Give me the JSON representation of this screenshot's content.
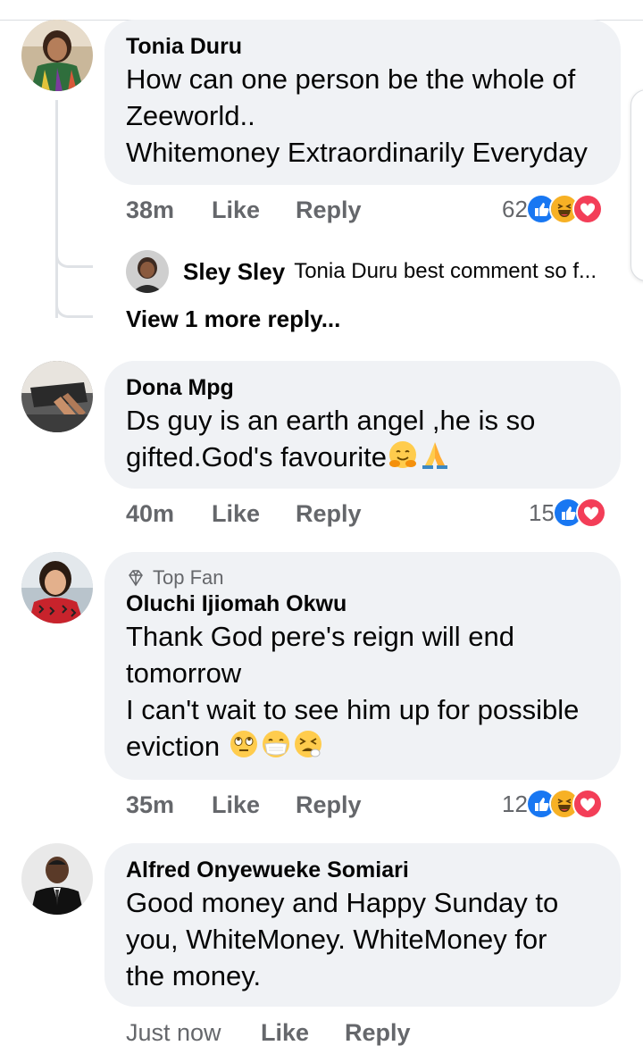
{
  "comments": [
    {
      "author": "Tonia Duru",
      "lines": [
        "How can one person be the whole of",
        "Zeeworld..",
        "Whitemoney Extraordinarily Everyday"
      ],
      "time": "38m",
      "like": "Like",
      "reply": "Reply",
      "reaction_count": "62",
      "reactions": [
        "like-icon",
        "haha-icon",
        "love-icon"
      ]
    },
    {
      "author": "Dona Mpg",
      "lines": [
        "Ds guy is an earth angel ,he is so",
        "gifted.God's favourite"
      ],
      "emojis": [
        "hugging-face-emoji",
        "folded-hands-emoji"
      ],
      "time": "40m",
      "like": "Like",
      "reply": "Reply",
      "reaction_count": "15",
      "reactions": [
        "like-icon",
        "love-icon"
      ]
    },
    {
      "badge": "Top Fan",
      "author": "Oluchi Ijiomah Okwu",
      "lines": [
        "Thank God pere's reign will end",
        "tomorrow",
        "I can't wait to see him up for possible",
        "eviction"
      ],
      "emojis": [
        "eye-roll-emoji",
        "mask-emoji",
        "tired-face-emoji"
      ],
      "time": "35m",
      "like": "Like",
      "reply": "Reply",
      "reaction_count": "12",
      "reactions": [
        "like-icon",
        "haha-icon",
        "love-icon"
      ]
    },
    {
      "author": "Alfred Onyewueke Somiari",
      "lines": [
        "Good money and Happy Sunday to",
        "you, WhiteMoney. WhiteMoney for",
        "the money."
      ],
      "time": "Just now",
      "like": "Like",
      "reply": "Reply"
    }
  ],
  "reply": {
    "author": "Sley Sley",
    "text": "Tonia Duru  best comment so f..."
  },
  "view_more": "View 1 more reply...",
  "colors": {
    "bubble": "#f0f2f5",
    "meta_text": "#65676b",
    "like_blue": "#1877f2",
    "love_red": "#f33e58",
    "haha_yellow": "#f7b125"
  }
}
